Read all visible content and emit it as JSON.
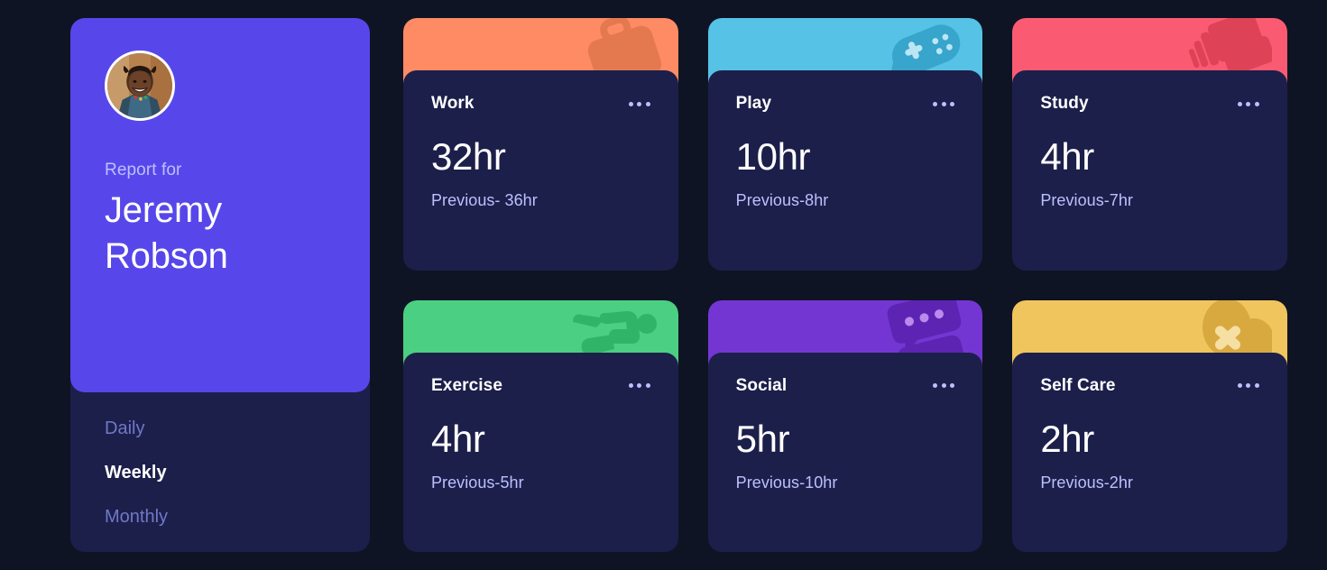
{
  "theme": {
    "page_background": "#0F1424",
    "card_background": "#1C1F4A",
    "accent_purple": "#5747EA",
    "muted_text": "#BBC0FF",
    "inactive_nav": "#7078C9"
  },
  "sidebar": {
    "avatar_name": "avatar",
    "report_label": "Report for",
    "user_name": "Jeremy Robson",
    "nav": [
      {
        "label": "Daily",
        "active": false
      },
      {
        "label": "Weekly",
        "active": true
      },
      {
        "label": "Monthly",
        "active": false
      }
    ]
  },
  "cards": [
    {
      "title": "Work",
      "hours": "32hr",
      "previous": "Previous- 36hr",
      "color": "#FF8B64",
      "icon_color": "#E4794F",
      "icon": "briefcase-icon",
      "menu_label": "ellipsis-menu"
    },
    {
      "title": "Play",
      "hours": "10hr",
      "previous": "Previous-8hr",
      "color": "#55C2E6",
      "icon_color": "#37A5CC",
      "icon": "game-controller-icon",
      "menu_label": "ellipsis-menu"
    },
    {
      "title": "Study",
      "hours": "4hr",
      "previous": "Previous-7hr",
      "color": "#FB5B72",
      "icon_color": "#DE4257",
      "icon": "books-icon",
      "menu_label": "ellipsis-menu"
    },
    {
      "title": "Exercise",
      "hours": "4hr",
      "previous": "Previous-5hr",
      "color": "#4BCF82",
      "icon_color": "#30B568",
      "icon": "running-person-icon",
      "menu_label": "ellipsis-menu"
    },
    {
      "title": "Social",
      "hours": "5hr",
      "previous": "Previous-10hr",
      "color": "#7436D3",
      "icon_color": "#5D24B3",
      "icon": "chat-bubbles-icon",
      "menu_label": "ellipsis-menu"
    },
    {
      "title": "Self Care",
      "hours": "2hr",
      "previous": "Previous-2hr",
      "color": "#F1C55D",
      "icon_color": "#D8A93F",
      "icon": "self-care-icon",
      "menu_label": "ellipsis-menu"
    }
  ]
}
